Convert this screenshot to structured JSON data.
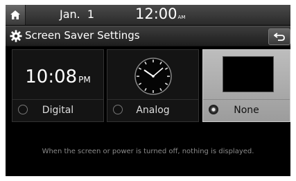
{
  "status": {
    "date": "Jan.  1",
    "time": "12:00",
    "time_suffix": "AM"
  },
  "header": {
    "title": "Screen Saver Settings",
    "icons": {
      "home": "home-icon",
      "settings": "gear-icon",
      "back": "back-arrow-icon"
    }
  },
  "options": [
    {
      "label": "Digital",
      "preview": "10:08",
      "preview_suffix": "PM",
      "selected": false
    },
    {
      "label": "Analog",
      "selected": false
    },
    {
      "label": "None",
      "selected": true
    }
  ],
  "message": "When the screen or power is turned off, nothing is displayed.",
  "colors": {
    "selected_card": "#b0b0b0",
    "background": "#000000",
    "message_text": "#8a8a8a"
  }
}
